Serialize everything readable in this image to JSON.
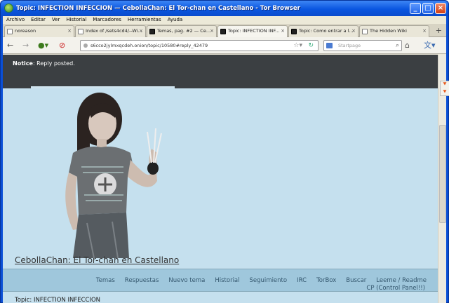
{
  "window": {
    "title": "Topic: INFECTION INFECCION — CebollaChan: El Tor-chan en Castellano - Tor Browser"
  },
  "menu": [
    "Archivo",
    "Editar",
    "Ver",
    "Historial",
    "Marcadores",
    "Herramientas",
    "Ayuda"
  ],
  "tabs": [
    {
      "label": "noreason",
      "active": false
    },
    {
      "label": "Index of /sets4cd4/--Wi...",
      "active": false
    },
    {
      "label": "Temas, pag. #2 — Ce...",
      "active": false
    },
    {
      "label": "Topic: INFECTION INF...",
      "active": true
    },
    {
      "label": "Topic: Como entrar a l...",
      "active": false
    },
    {
      "label": "The Hidden Wiki",
      "active": false
    }
  ],
  "address": {
    "url": "s6cco2jylmxqcdeh.onion/topic/10580#reply_42479"
  },
  "search": {
    "placeholder": "Startpage"
  },
  "page": {
    "notice_label": "Notice",
    "notice_text": ": Reply posted.",
    "site_title": "CebollaChan: El Tor-chan en Castellano",
    "nav": [
      "Temas",
      "Respuestas",
      "Nuevo tema",
      "Historial",
      "Seguimiento",
      "IRC",
      "TorBox",
      "Buscar",
      "Leeme / Readme"
    ],
    "nav_cp": "CP (Control Panel!!)",
    "topic_heading": "Topic: INFECTION INFECCION"
  },
  "colors": {
    "page_bg": "#c5e0ee",
    "notice_bg": "#3b3f42",
    "nav_bg": "#9fc7dc",
    "link": "#34576e"
  }
}
